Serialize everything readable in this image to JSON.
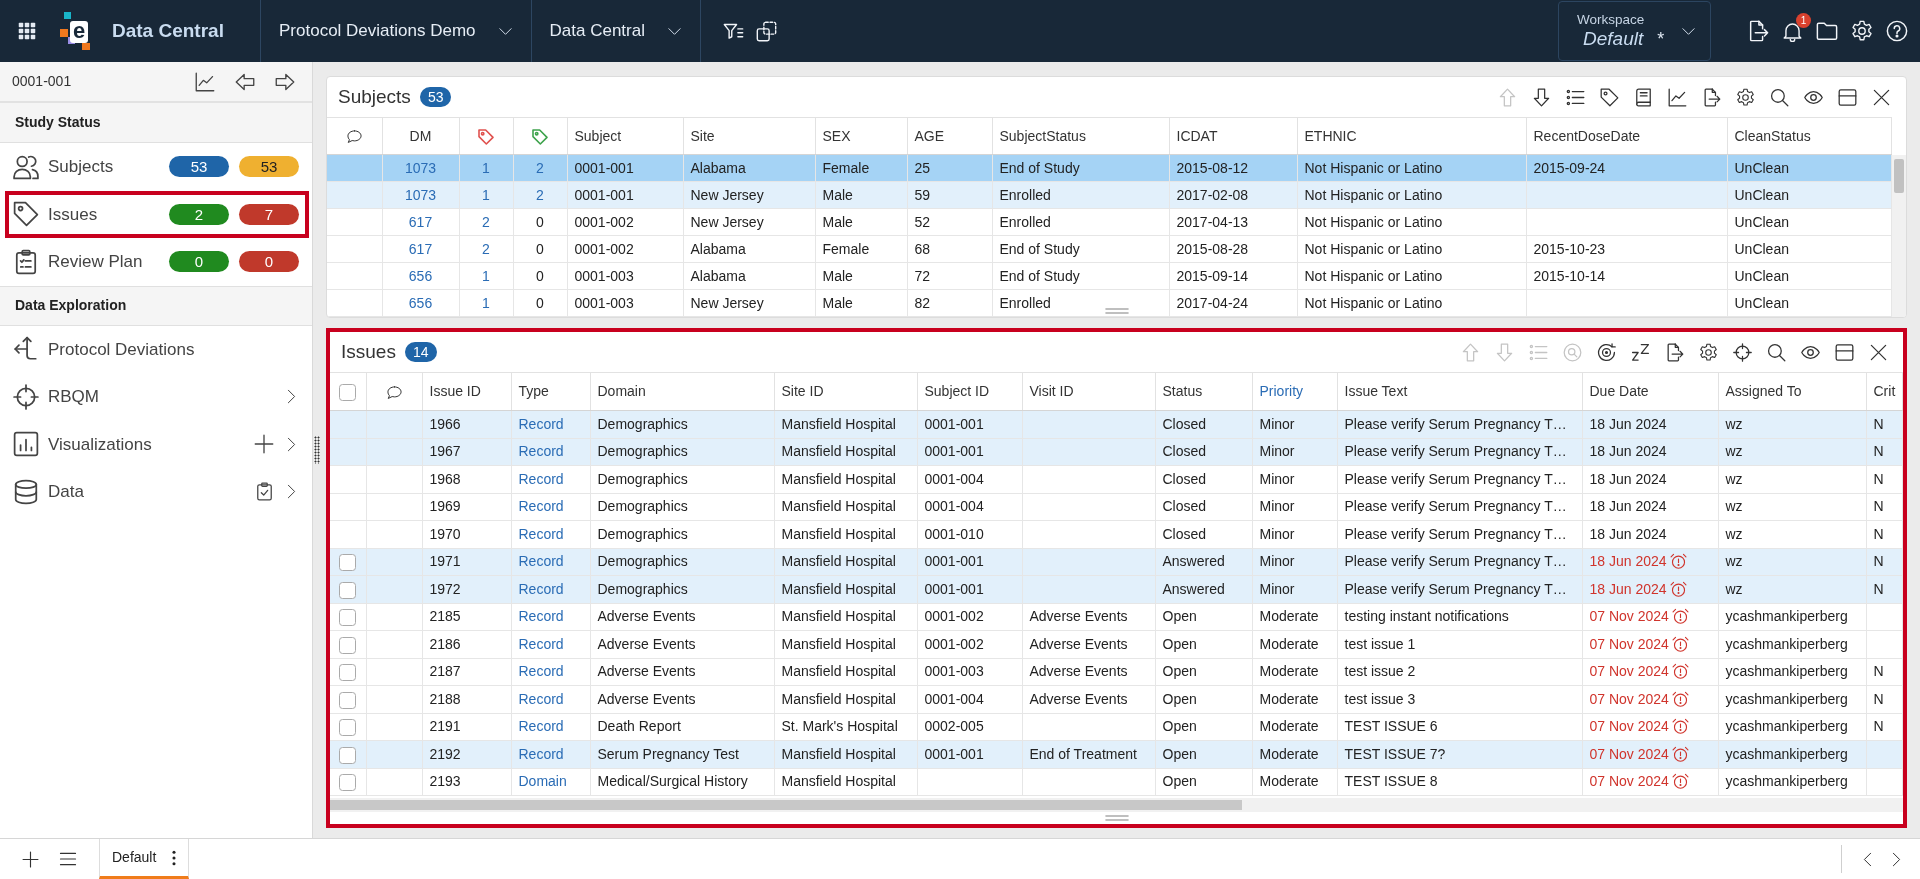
{
  "top_bar": {
    "logo_letter": "e",
    "app_name": "Data Central",
    "menus": [
      {
        "label": "Protocol Deviations Demo"
      },
      {
        "label": "Data Central"
      }
    ],
    "workspace": {
      "label": "Workspace",
      "name": "Default",
      "unsaved_mark": "*"
    },
    "notification_count": "1"
  },
  "sidebar": {
    "subject": "0001-001",
    "sections": [
      {
        "title": "Study Status",
        "items": [
          {
            "label": "Subjects",
            "outlined": false,
            "badges": [
              {
                "text": "53",
                "color": "#1f65a8"
              },
              {
                "text": "53",
                "color": "#efb030"
              }
            ]
          },
          {
            "label": "Issues",
            "outlined": true,
            "badges": [
              {
                "text": "2",
                "color": "#208a1f"
              },
              {
                "text": "7",
                "color": "#c0392b"
              }
            ]
          },
          {
            "label": "Review Plan",
            "outlined": false,
            "badges": [
              {
                "text": "0",
                "color": "#208a1f"
              },
              {
                "text": "0",
                "color": "#c0392b"
              }
            ]
          }
        ]
      },
      {
        "title": "Data Exploration",
        "items": [
          {
            "label": "Protocol Deviations",
            "expandable": false
          },
          {
            "label": "RBQM",
            "expandable": true
          },
          {
            "label": "Visualizations",
            "expandable": true
          },
          {
            "label": "Data",
            "expandable": true
          }
        ]
      }
    ]
  },
  "subjects": {
    "title": "Subjects",
    "count": "53",
    "outlined": false,
    "toolbar": [
      {
        "disabled": true
      },
      {
        "disabled": false
      },
      {
        "disabled": false
      },
      {
        "disabled": false
      },
      {
        "disabled": false
      },
      {
        "disabled": false
      },
      {
        "disabled": false
      },
      {
        "disabled": false
      },
      {
        "disabled": false
      },
      {
        "disabled": false
      },
      {
        "disabled": false
      },
      {
        "disabled": false
      }
    ],
    "columns": [
      {
        "kind": "comment"
      },
      {
        "kind": "link",
        "label": "DM"
      },
      {
        "kind": "count",
        "color": "#e0524f"
      },
      {
        "kind": "count",
        "color": "#3fa34d"
      },
      {
        "kind": "text",
        "label": "Subject"
      },
      {
        "kind": "text",
        "label": "Site"
      },
      {
        "kind": "text",
        "label": "SEX"
      },
      {
        "kind": "text",
        "label": "AGE"
      },
      {
        "kind": "text",
        "label": "SubjectStatus"
      },
      {
        "kind": "text",
        "label": "ICDAT"
      },
      {
        "kind": "text",
        "label": "ETHNIC"
      },
      {
        "kind": "text",
        "label": "RecentDoseDate"
      },
      {
        "kind": "text",
        "label": "CleanStatus"
      }
    ],
    "rows": [
      {
        "selected": true,
        "cells": [
          "",
          "1073",
          {
            "text": "1",
            "link": true
          },
          {
            "text": "2",
            "link": true
          },
          "0001-001",
          "Alabama",
          "Female",
          "25",
          "End of Study",
          "2015-08-12",
          "Not Hispanic or Latino",
          "2015-09-24",
          "UnClean"
        ]
      },
      {
        "selected": false,
        "highlighted": true,
        "cells": [
          "",
          "1073",
          {
            "text": "1",
            "link": true
          },
          {
            "text": "2",
            "link": true
          },
          "0001-001",
          "New Jersey",
          "Male",
          "59",
          "Enrolled",
          "2017-02-08",
          "Not Hispanic or Latino",
          "",
          "UnClean"
        ]
      },
      {
        "selected": false,
        "highlighted": false,
        "cells": [
          "",
          "617",
          {
            "text": "2",
            "link": true
          },
          {
            "text": "0",
            "link": false
          },
          "0001-002",
          "New Jersey",
          "Male",
          "52",
          "Enrolled",
          "2017-04-13",
          "Not Hispanic or Latino",
          "",
          "UnClean"
        ]
      },
      {
        "selected": false,
        "highlighted": false,
        "cells": [
          "",
          "617",
          {
            "text": "2",
            "link": true
          },
          {
            "text": "0",
            "link": false
          },
          "0001-002",
          "Alabama",
          "Female",
          "68",
          "End of Study",
          "2015-08-28",
          "Not Hispanic or Latino",
          "2015-10-23",
          "UnClean"
        ]
      },
      {
        "selected": false,
        "highlighted": false,
        "cells": [
          "",
          "656",
          {
            "text": "1",
            "link": true
          },
          {
            "text": "0",
            "link": false
          },
          "0001-003",
          "Alabama",
          "Male",
          "72",
          "End of Study",
          "2015-09-14",
          "Not Hispanic or Latino",
          "2015-10-14",
          "UnClean"
        ]
      },
      {
        "selected": false,
        "highlighted": false,
        "cells": [
          "",
          "656",
          {
            "text": "1",
            "link": true
          },
          {
            "text": "0",
            "link": false
          },
          "0001-003",
          "New Jersey",
          "Male",
          "82",
          "Enrolled",
          "2017-04-24",
          "Not Hispanic or Latino",
          "",
          "UnClean"
        ]
      }
    ]
  },
  "issues": {
    "title": "Issues",
    "count": "14",
    "outlined": true,
    "toolbar": [
      {
        "disabled": true
      },
      {
        "disabled": true
      },
      {
        "disabled": true
      },
      {
        "disabled": true
      },
      {
        "disabled": false
      },
      {
        "disabled": false
      },
      {
        "disabled": false
      },
      {
        "disabled": false
      },
      {
        "disabled": false
      },
      {
        "disabled": false
      },
      {
        "disabled": false
      },
      {
        "disabled": false
      },
      {
        "disabled": false
      }
    ],
    "columns": [
      {
        "kind": "checkbox",
        "checked": false
      },
      {
        "kind": "comment"
      },
      {
        "kind": "text",
        "label": "Issue ID",
        "sorted": false
      },
      {
        "kind": "link",
        "label": "Type",
        "sorted": false
      },
      {
        "kind": "text",
        "label": "Domain",
        "sorted": false
      },
      {
        "kind": "text",
        "label": "Site ID",
        "sorted": false
      },
      {
        "kind": "text",
        "label": "Subject ID",
        "sorted": false
      },
      {
        "kind": "text",
        "label": "Visit ID",
        "sorted": false
      },
      {
        "kind": "text",
        "label": "Status",
        "sorted": false
      },
      {
        "kind": "text",
        "label": "Priority",
        "sorted": true
      },
      {
        "kind": "text",
        "label": "Issue Text",
        "sorted": false
      },
      {
        "kind": "due",
        "label": "Due Date",
        "sorted": false
      },
      {
        "kind": "text",
        "label": "Assigned To",
        "sorted": false
      },
      {
        "kind": "text",
        "label": "Crit",
        "sorted": false
      }
    ],
    "rows": [
      {
        "highlighted": true,
        "overdue": false,
        "cells": [
          "",
          "",
          "1966",
          "Record",
          "Demographics",
          "Mansfield Hospital",
          "0001-001",
          "",
          "Closed",
          "Minor",
          "Please verify Serum Pregnancy T…",
          "18 Jun 2024",
          "wz",
          "N"
        ]
      },
      {
        "highlighted": true,
        "overdue": false,
        "cells": [
          "",
          "",
          "1967",
          "Record",
          "Demographics",
          "Mansfield Hospital",
          "0001-001",
          "",
          "Closed",
          "Minor",
          "Please verify Serum Pregnancy T…",
          "18 Jun 2024",
          "wz",
          "N"
        ]
      },
      {
        "highlighted": false,
        "overdue": false,
        "cells": [
          "",
          "",
          "1968",
          "Record",
          "Demographics",
          "Mansfield Hospital",
          "0001-004",
          "",
          "Closed",
          "Minor",
          "Please verify Serum Pregnancy T…",
          "18 Jun 2024",
          "wz",
          "N"
        ]
      },
      {
        "highlighted": false,
        "overdue": false,
        "cells": [
          "",
          "",
          "1969",
          "Record",
          "Demographics",
          "Mansfield Hospital",
          "0001-004",
          "",
          "Closed",
          "Minor",
          "Please verify Serum Pregnancy T…",
          "18 Jun 2024",
          "wz",
          "N"
        ]
      },
      {
        "highlighted": false,
        "overdue": false,
        "cells": [
          "",
          "",
          "1970",
          "Record",
          "Demographics",
          "Mansfield Hospital",
          "0001-010",
          "",
          "Closed",
          "Minor",
          "Please verify Serum Pregnancy T…",
          "18 Jun 2024",
          "wz",
          "N"
        ]
      },
      {
        "checked": false,
        "highlighted": true,
        "overdue": true,
        "cells": [
          "",
          "",
          "1971",
          "Record",
          "Demographics",
          "Mansfield Hospital",
          "0001-001",
          "",
          "Answered",
          "Minor",
          "Please verify Serum Pregnancy T…",
          "18 Jun 2024",
          "wz",
          "N"
        ]
      },
      {
        "checked": false,
        "highlighted": true,
        "overdue": true,
        "cells": [
          "",
          "",
          "1972",
          "Record",
          "Demographics",
          "Mansfield Hospital",
          "0001-001",
          "",
          "Answered",
          "Minor",
          "Please verify Serum Pregnancy T…",
          "18 Jun 2024",
          "wz",
          "N"
        ]
      },
      {
        "checked": false,
        "highlighted": false,
        "overdue": true,
        "cells": [
          "",
          "",
          "2185",
          "Record",
          "Adverse Events",
          "Mansfield Hospital",
          "0001-002",
          "Adverse Events",
          "Open",
          "Moderate",
          "testing instant notifications",
          "07 Nov 2024",
          "ycashmankiperberg",
          ""
        ]
      },
      {
        "checked": false,
        "highlighted": false,
        "overdue": true,
        "cells": [
          "",
          "",
          "2186",
          "Record",
          "Adverse Events",
          "Mansfield Hospital",
          "0001-002",
          "Adverse Events",
          "Open",
          "Moderate",
          "test issue 1",
          "07 Nov 2024",
          "ycashmankiperberg",
          ""
        ]
      },
      {
        "checked": false,
        "highlighted": false,
        "overdue": true,
        "cells": [
          "",
          "",
          "2187",
          "Record",
          "Adverse Events",
          "Mansfield Hospital",
          "0001-003",
          "Adverse Events",
          "Open",
          "Moderate",
          "test issue 2",
          "07 Nov 2024",
          "ycashmankiperberg",
          "N"
        ]
      },
      {
        "checked": false,
        "highlighted": false,
        "overdue": true,
        "cells": [
          "",
          "",
          "2188",
          "Record",
          "Adverse Events",
          "Mansfield Hospital",
          "0001-004",
          "Adverse Events",
          "Open",
          "Moderate",
          "test issue 3",
          "07 Nov 2024",
          "ycashmankiperberg",
          "N"
        ]
      },
      {
        "checked": false,
        "highlighted": false,
        "overdue": true,
        "cells": [
          "",
          "",
          "2191",
          "Record",
          "Death Report",
          "St. Mark's Hospital",
          "0002-005",
          "",
          "Open",
          "Moderate",
          "TEST ISSUE 6",
          "07 Nov 2024",
          "ycashmankiperberg",
          "N"
        ]
      },
      {
        "checked": false,
        "highlighted": true,
        "overdue": true,
        "cells": [
          "",
          "",
          "2192",
          "Record",
          "Serum Pregnancy Test",
          "Mansfield Hospital",
          "0001-001",
          "End of Treatment",
          "Open",
          "Moderate",
          "TEST ISSUE 7?",
          "07 Nov 2024",
          "ycashmankiperberg",
          ""
        ]
      },
      {
        "checked": false,
        "highlighted": false,
        "overdue": true,
        "cells": [
          "",
          "",
          "2193",
          "Domain",
          "Medical/Surgical History",
          "Mansfield Hospital",
          "",
          "",
          "Open",
          "Moderate",
          "TEST ISSUE 8",
          "07 Nov 2024",
          "ycashmankiperberg",
          ""
        ]
      }
    ]
  },
  "bottom_bar": {
    "tabs": [
      {
        "label": "Default",
        "selected": true
      }
    ]
  }
}
